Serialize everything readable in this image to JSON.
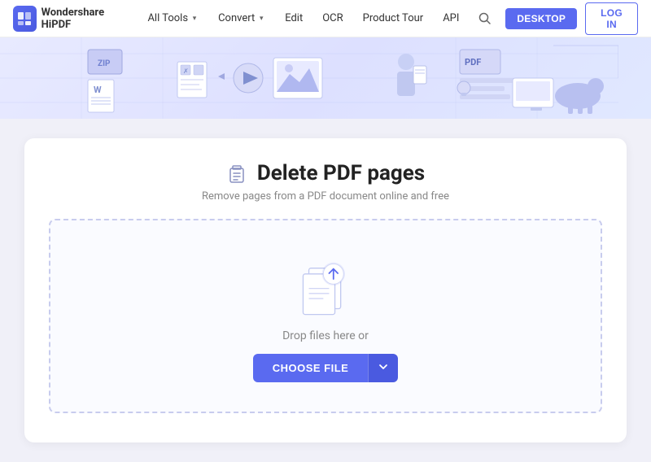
{
  "nav": {
    "logo_text": "Wondershare HiPDF",
    "items": [
      {
        "label": "All Tools",
        "has_dropdown": true
      },
      {
        "label": "Convert",
        "has_dropdown": true
      },
      {
        "label": "Edit",
        "has_dropdown": false
      },
      {
        "label": "OCR",
        "has_dropdown": false
      },
      {
        "label": "Product Tour",
        "has_dropdown": false
      },
      {
        "label": "API",
        "has_dropdown": false
      }
    ],
    "desktop_btn": "DESKTOP",
    "login_btn": "LOG IN"
  },
  "page": {
    "title": "Delete PDF pages",
    "subtitle": "Remove pages from a PDF document online and free",
    "drop_text": "Drop files here or",
    "choose_label": "CHOOSE FILE"
  }
}
